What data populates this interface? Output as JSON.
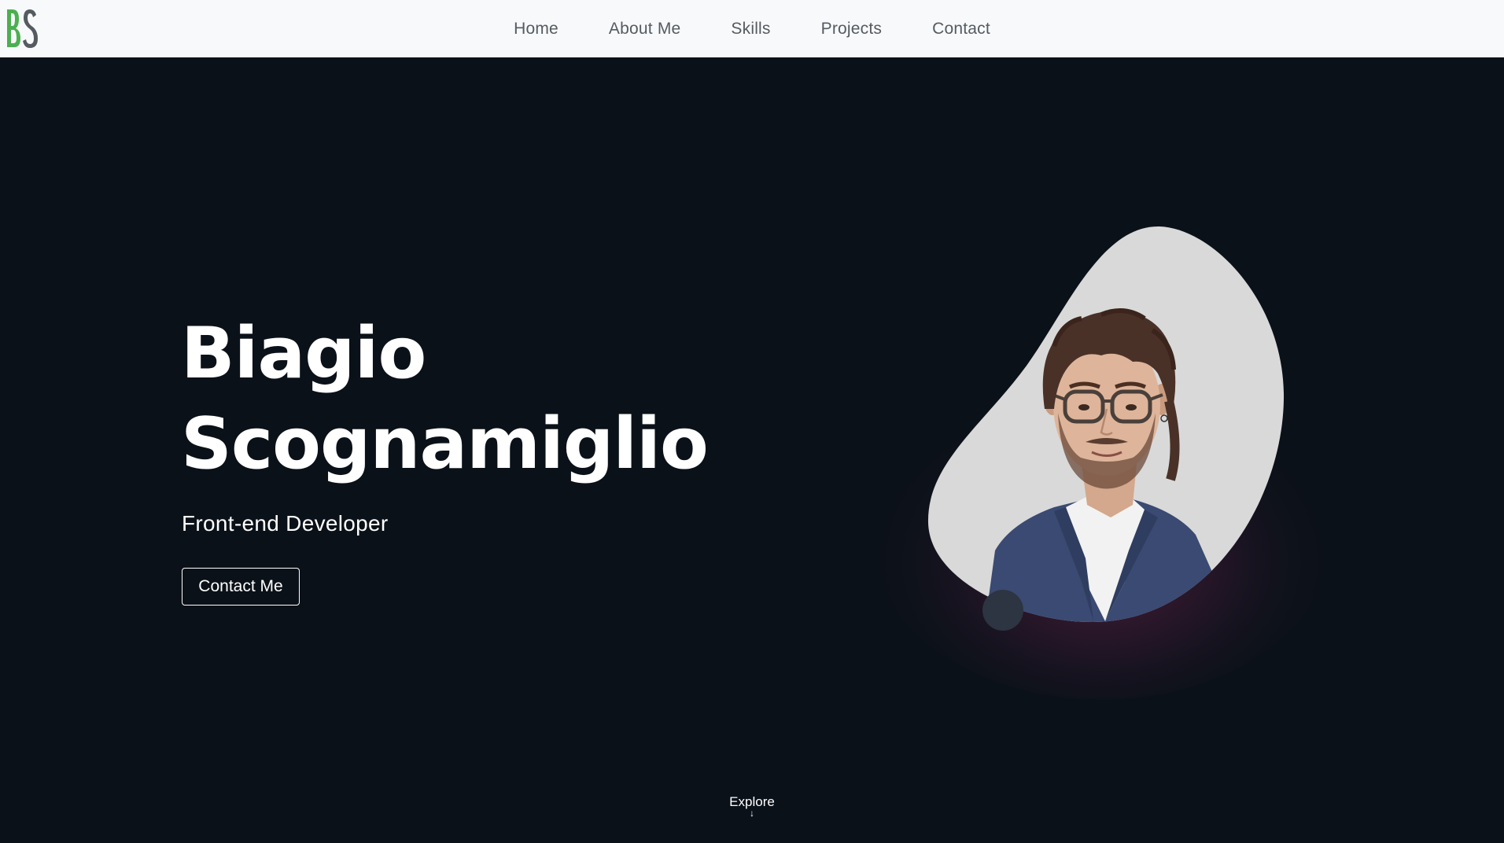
{
  "brand": {
    "logo_text": "BS",
    "logo_colors": {
      "b": "#4caf50",
      "s": "#555b61"
    }
  },
  "nav": {
    "items": [
      {
        "label": "Home"
      },
      {
        "label": "About Me"
      },
      {
        "label": "Skills"
      },
      {
        "label": "Projects"
      },
      {
        "label": "Contact"
      }
    ]
  },
  "hero": {
    "first_name": "Biagio",
    "last_name": "Scognamiglio",
    "role": "Front-end Developer",
    "cta_label": "Contact Me"
  },
  "portrait": {
    "blob_color": "#d9d9d9",
    "glow_color": "#8a2a5a",
    "dot_color": "#2d3442"
  },
  "explore": {
    "label": "Explore",
    "arrow_icon": "arrow-down-icon"
  },
  "colors": {
    "background": "#0b1119",
    "navbar_bg": "#f8f9fa",
    "nav_text": "#555b61",
    "text": "#ffffff"
  }
}
